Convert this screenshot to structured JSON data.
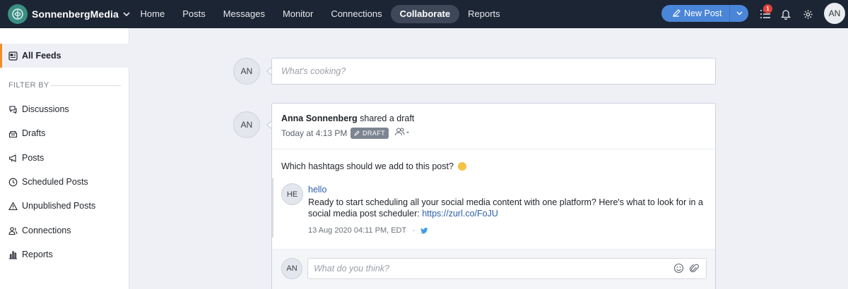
{
  "brand": {
    "name": "SonnenbergMedia"
  },
  "nav": {
    "items": [
      "Home",
      "Posts",
      "Messages",
      "Monitor",
      "Connections",
      "Collaborate",
      "Reports"
    ],
    "active": "Collaborate"
  },
  "toolbar": {
    "new_post_label": "New Post",
    "notification_count": "1",
    "user_initials": "AN"
  },
  "colors": {
    "topbar": "#1c2533",
    "accent": "#4a86d8",
    "active_marker": "#f28c28",
    "badge": "#e2423a"
  },
  "sidebar": {
    "all_feeds": "All Feeds",
    "filter_heading": "FILTER BY",
    "items": [
      {
        "label": "Discussions",
        "icon": "discussions-icon"
      },
      {
        "label": "Drafts",
        "icon": "drafts-icon"
      },
      {
        "label": "Posts",
        "icon": "megaphone-icon"
      },
      {
        "label": "Scheduled Posts",
        "icon": "clock-icon"
      },
      {
        "label": "Unpublished Posts",
        "icon": "warning-icon"
      },
      {
        "label": "Connections",
        "icon": "connections-icon"
      },
      {
        "label": "Reports",
        "icon": "bar-chart-icon"
      }
    ]
  },
  "composer": {
    "avatar": "AN",
    "placeholder": "What's cooking?"
  },
  "post": {
    "avatar": "AN",
    "author": "Anna Sonnenberg",
    "action": "shared a draft",
    "time": "Today at 4:13 PM",
    "status": "DRAFT",
    "question": "Which hashtags should we add to this post?",
    "quoted": {
      "avatar": "HE",
      "title": "hello",
      "body": "Ready to start scheduling all your social media content with one platform? Here's what to look for in a social media post scheduler: ",
      "link": "https://zurl.co/FoJU",
      "timestamp": "13 Aug 2020 04:11 PM, EDT",
      "separator": "·",
      "network_icon": "twitter-icon"
    },
    "reply": {
      "avatar": "AN",
      "placeholder": "What do you think?"
    }
  }
}
